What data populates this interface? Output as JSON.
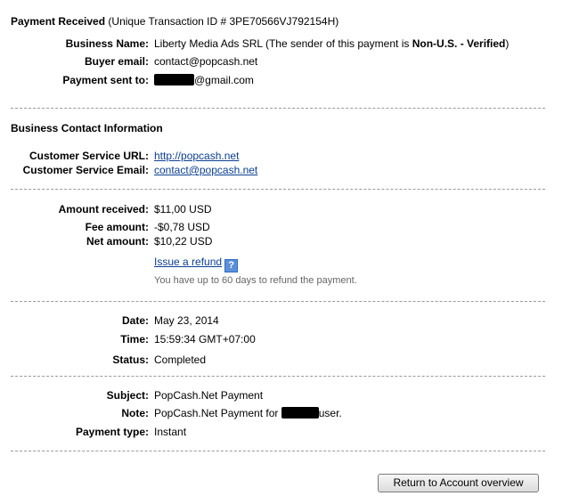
{
  "header": {
    "title": "Payment Received",
    "transaction": "(Unique Transaction ID # 3PE70566VJ792154H)"
  },
  "payment": {
    "business_name_label": "Business Name:",
    "business_name_value": "Liberty Media Ads SRL (The sender of this payment is ",
    "sender_status": "Non-U.S. - Verified",
    "business_name_close": ")",
    "buyer_email_label": "Buyer email:",
    "buyer_email_value": "contact@popcash.net",
    "sent_to_label": "Payment sent to:",
    "sent_to_suffix": "@gmail.com"
  },
  "contact": {
    "heading": "Business Contact Information",
    "url_label": "Customer Service URL:",
    "url_value": "http://popcash.net",
    "email_label": "Customer Service Email:",
    "email_value": "contact@popcash.net"
  },
  "amounts": {
    "received_label": "Amount received:",
    "received_value": "$11,00 USD",
    "fee_label": "Fee amount:",
    "fee_value": "-$0,78 USD",
    "net_label": "Net amount:",
    "net_value": "$10,22 USD",
    "refund_link": "Issue a refund",
    "help_icon": "question-mark-icon",
    "help_glyph": "?",
    "refund_note": "You have up to 60 days to refund the payment."
  },
  "details": {
    "date_label": "Date:",
    "date_value": "May 23, 2014",
    "time_label": "Time:",
    "time_value": "15:59:34 GMT+07:00",
    "status_label": "Status:",
    "status_value": "Completed"
  },
  "message": {
    "subject_label": "Subject:",
    "subject_value": "PopCash.Net Payment",
    "note_label": "Note:",
    "note_prefix": "PopCash.Net Payment for ",
    "note_suffix": "user.",
    "type_label": "Payment type:",
    "type_value": "Instant"
  },
  "actions": {
    "return_button": "Return to Account overview"
  },
  "colors": {
    "link": "#0b3f8f",
    "help_icon": "#5b8fd8",
    "separator": "#9a9a9a"
  }
}
